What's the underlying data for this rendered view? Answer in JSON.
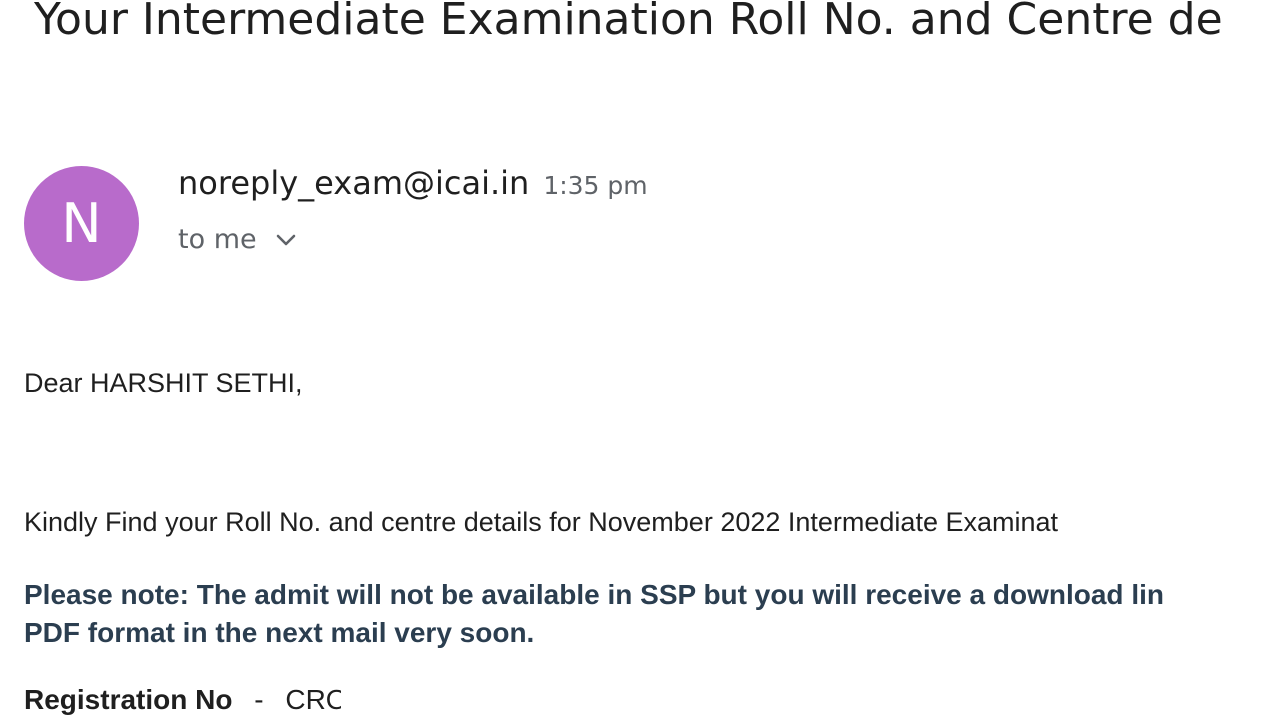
{
  "email": {
    "subject": "Your Intermediate Examination Roll No. and Centre de",
    "avatar_letter": "N",
    "avatar_color": "#b86bcb",
    "sender": "noreply_exam@icai.in",
    "time": "1:35 pm",
    "recipient": "to me",
    "expand_icon": "chevron-down-icon"
  },
  "body": {
    "greeting": "Dear HARSHIT SETHI,",
    "intro": "Kindly Find your Roll No. and centre details for  November 2022 Intermediate Examinat",
    "note_line1": "Please note: The admit will not be available in SSP but you will receive a download lin",
    "note_line2": "PDF format in the next mail very soon.",
    "note_color": "#2b3e50",
    "registration_label": "Registration No",
    "registration_separator": "-",
    "registration_value": "CRO"
  }
}
